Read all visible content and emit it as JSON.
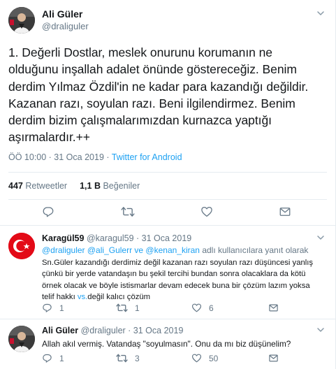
{
  "tweet": {
    "author_name": "Ali Güler",
    "author_handle": "@draliguler",
    "lines": [
      "1. Değerli Dostlar, meslek onurunu korumanın ne",
      "olduğunu inşallah adalet önünde göstereceğiz. Benim",
      "derdim Yılmaz Özdil'in ne kadar para kazandığı değildir.",
      "Kazanan razı, soyulan razı. Beni ilgilendirmez. Benim",
      "derdim bizim çalışmalarımızdan kurnazca yaptığı",
      "aşırmalardır.++"
    ],
    "time": "ÖÖ 10:00 · 31 Oca 2019 · ",
    "source": "Twitter for Android",
    "retweets_count": "447",
    "retweets_label": "Retweetler",
    "likes_count": "1,1 B",
    "likes_label": "Beğeniler"
  },
  "replies": [
    {
      "name": "Karagül59",
      "handle": "@karagul59",
      "date": "· 31 Oca 2019",
      "reply_to_mentions": "@draliguler @ali_Gulerr ve @kenan_kiran",
      "reply_to_suffix": " adlı kullanıcılara yanıt olarak",
      "text_lines": [
        "Sn.Güler kazandığı derdimiz değil kazanan razı soyulan razı düşüncesi yanlış",
        "çünkü bir yerde vatandaşın bu    şekil tercihi bundan sonra olacaklara da kötü",
        "örnek olacak ve böyle istismarlar devam edecek buna bir çözüm lazım yoksa"
      ],
      "last_line_before": "telif hakkı ",
      "last_line_link": "vs.",
      "last_line_after": "değil kalıcı çözüm",
      "reply_count": "1",
      "retweet_count": "1",
      "like_count": "6"
    },
    {
      "name": "Ali Güler",
      "handle": "@draliguler",
      "date": "· 31 Oca 2019",
      "text": "Allah akıl vermiş. Vatandaş \"soyulmasın\". Onu da mı biz düşünelim?",
      "reply_count": "1",
      "retweet_count": "3",
      "like_count": "50"
    }
  ],
  "colors": {
    "text": "#14171a",
    "muted": "#657786",
    "link": "#1da1f2",
    "border": "#e6ecf0"
  }
}
